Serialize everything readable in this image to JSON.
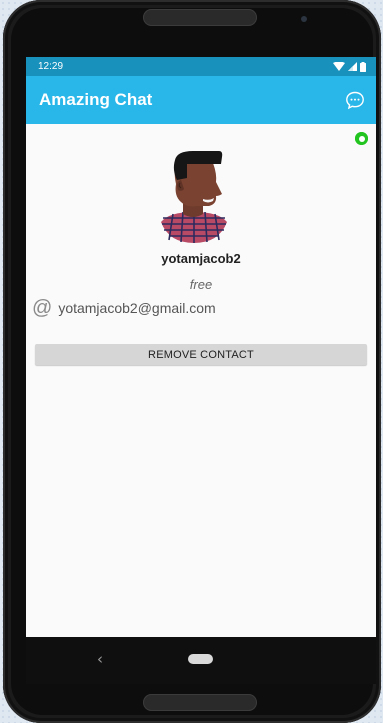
{
  "status_bar": {
    "time": "12:29"
  },
  "app_bar": {
    "title": "Amazing Chat",
    "chat_icon": "chat-bubble-icon"
  },
  "profile": {
    "presence_color": "#22c41f",
    "username": "yotamjacob2",
    "status": "free",
    "email_icon": "at-icon",
    "email": "yotamjacob2@gmail.com",
    "remove_button_label": "REMOVE CONTACT"
  },
  "colors": {
    "status_bar": "#1891bd",
    "app_bar": "#29b6e8",
    "button": "#d6d6d6"
  }
}
